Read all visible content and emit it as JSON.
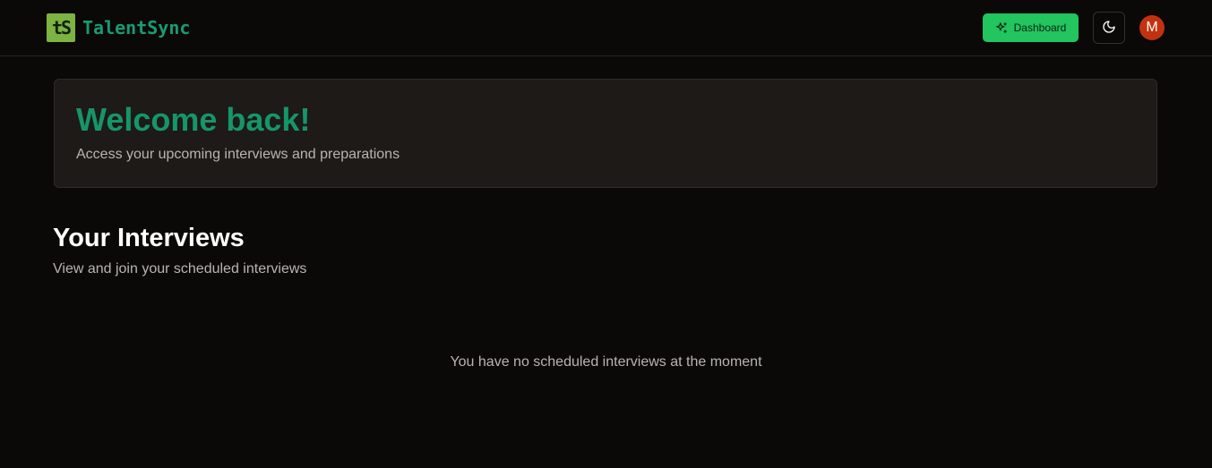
{
  "header": {
    "logo_text": "tS",
    "brand_name": "TalentSync",
    "dashboard_label": "Dashboard",
    "avatar_initial": "M",
    "colors": {
      "brand": "#1a9a72",
      "logo_bg": "#7cb342",
      "dashboard_bg": "#22c55e",
      "avatar_bg": "#c2320f"
    },
    "icons": {
      "dashboard": "sparkles-icon",
      "theme": "moon-icon"
    }
  },
  "welcome": {
    "title": "Welcome back!",
    "subtitle": "Access your upcoming interviews and preparations"
  },
  "interviews": {
    "title": "Your Interviews",
    "subtitle": "View and join your scheduled interviews",
    "empty_message": "You have no scheduled interviews at the moment"
  }
}
